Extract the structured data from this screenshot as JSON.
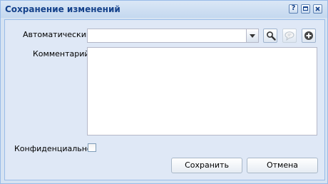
{
  "window": {
    "title": "Сохранение изменений",
    "tools": {
      "help_label": "?"
    }
  },
  "form": {
    "auto_label": "Автоматический:",
    "auto_value": "",
    "comment_label": "Комментарий:",
    "comment_value": "",
    "confidential_label": "Конфиденциально:",
    "confidential_checked": false
  },
  "buttons": {
    "save_label": "Сохранить",
    "cancel_label": "Отмена"
  },
  "icons": {
    "search": "search-icon",
    "comment": "comment-icon",
    "add": "add-icon",
    "dropdown": "chevron-down-icon"
  },
  "colors": {
    "title_text": "#15428b",
    "panel_bg": "#dfe8f6",
    "border": "#99bbe8",
    "add_icon": "#444444"
  }
}
